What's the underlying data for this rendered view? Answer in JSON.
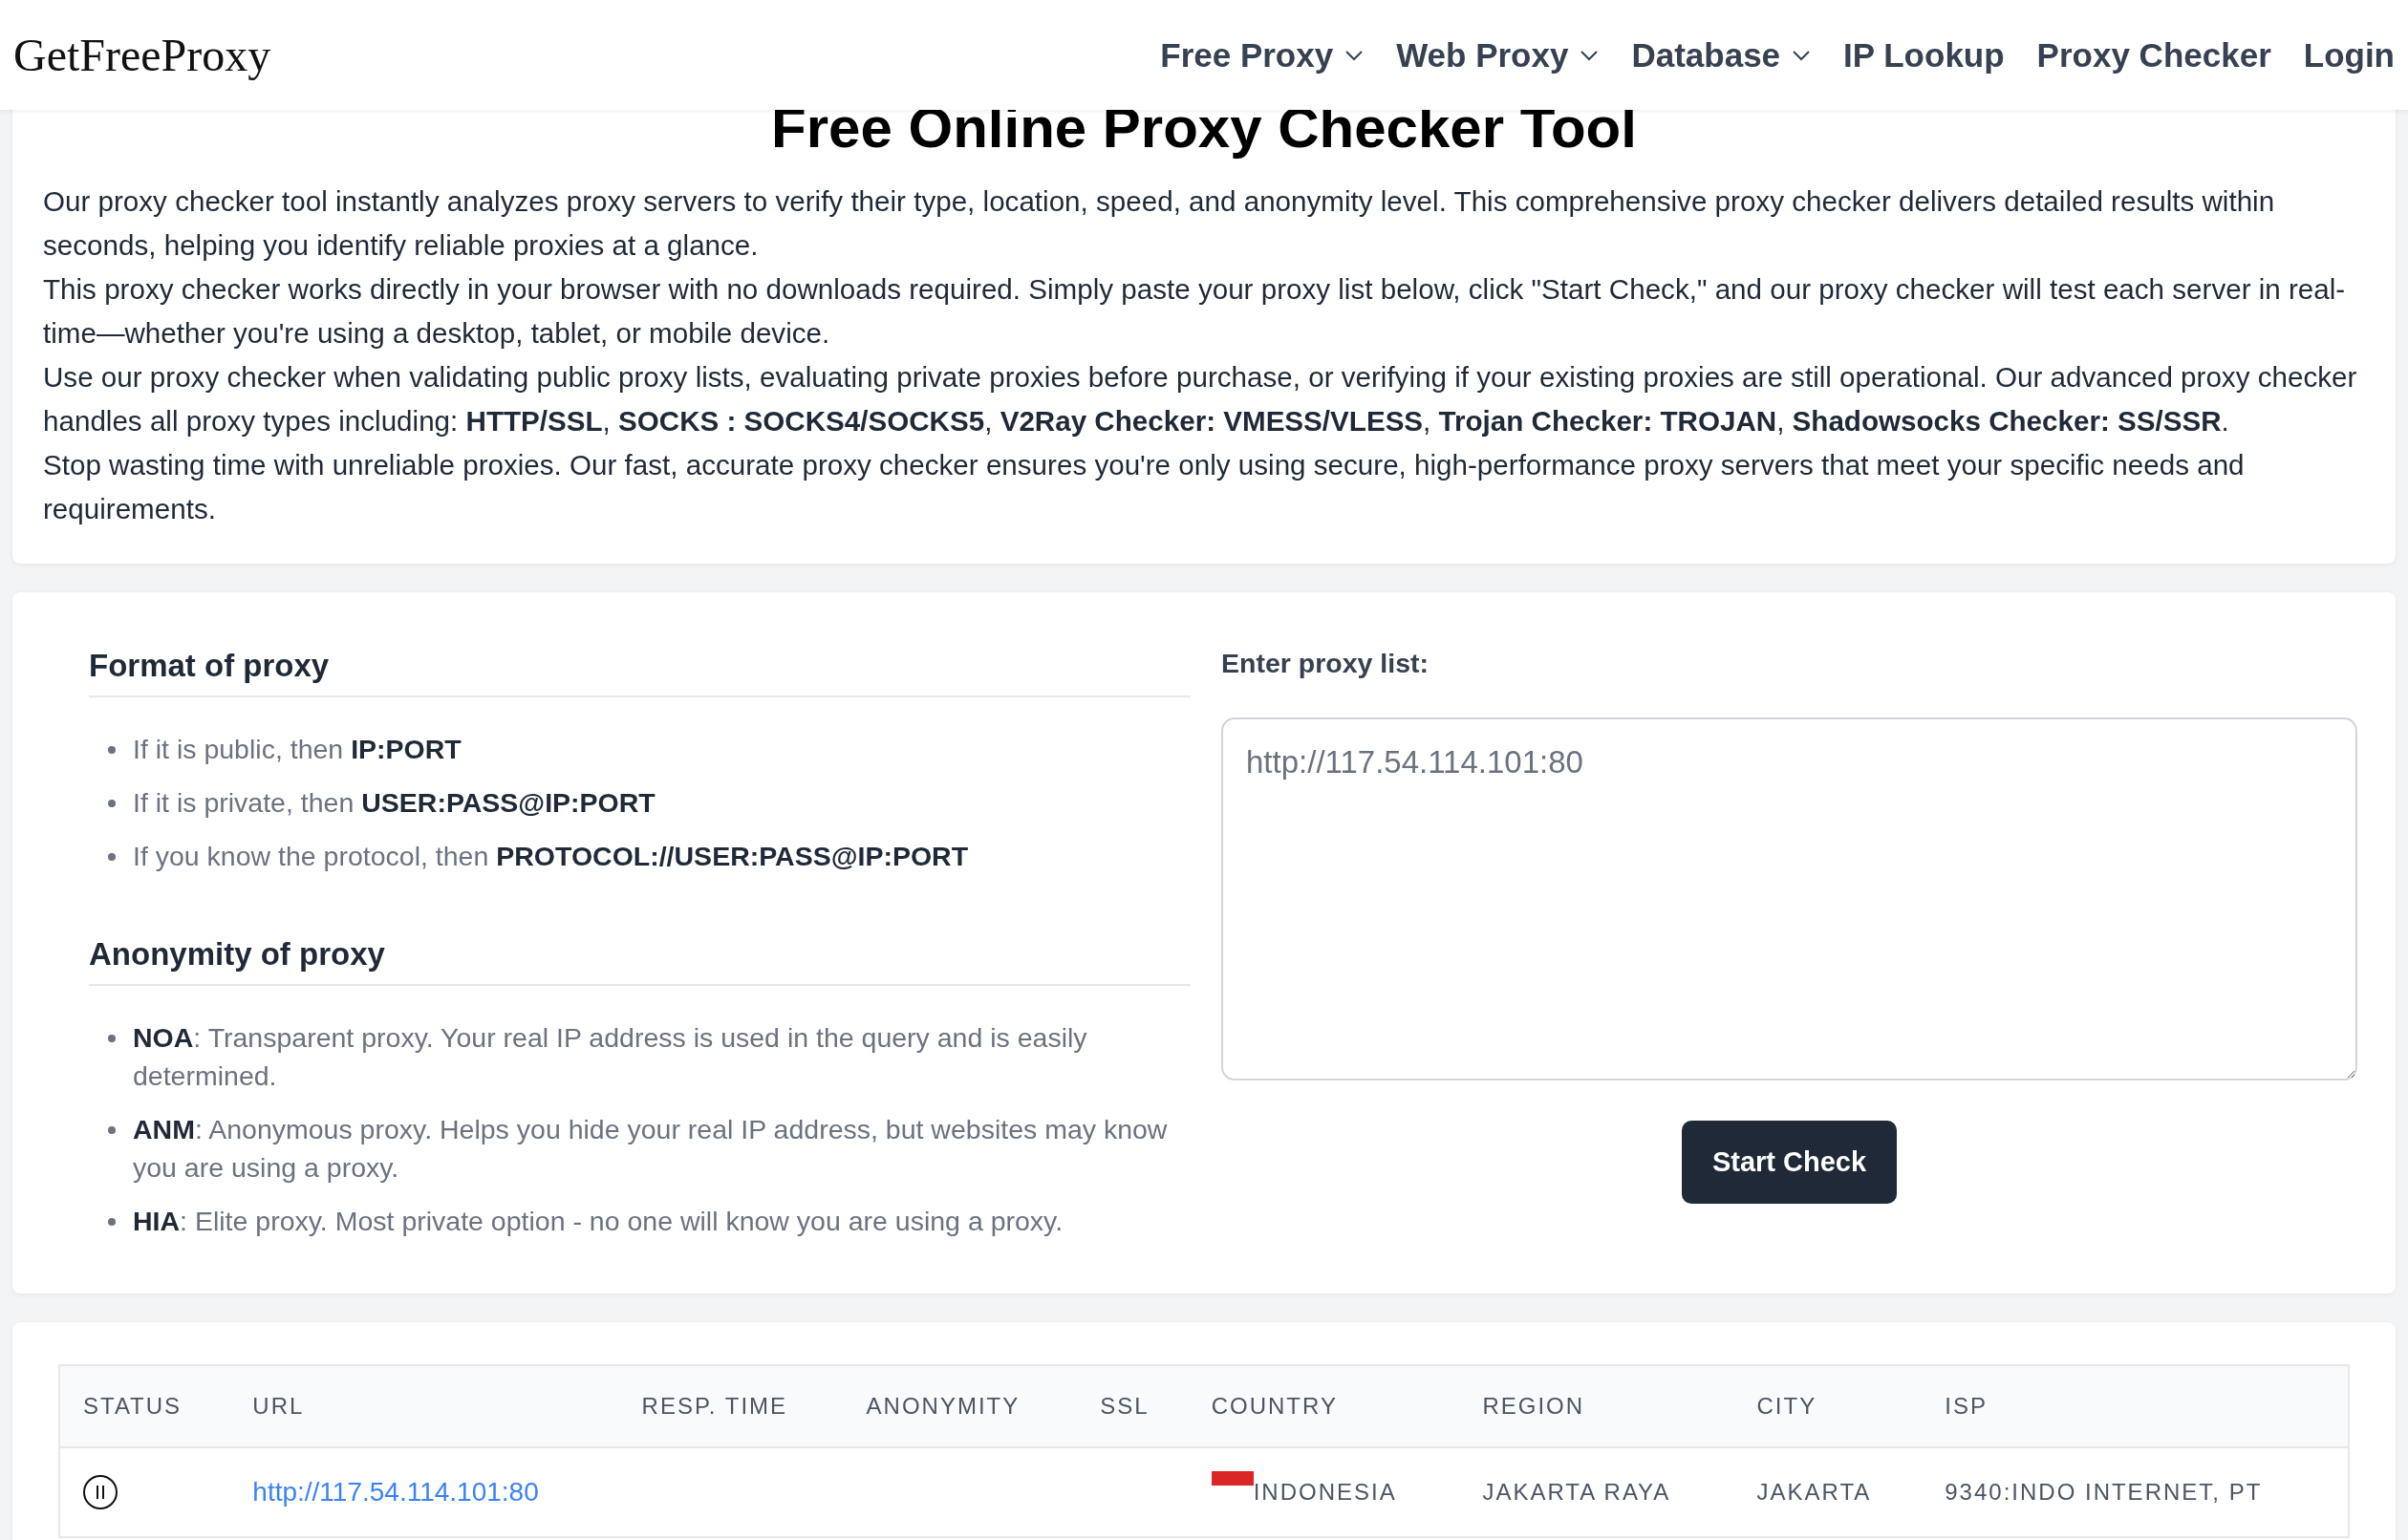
{
  "header": {
    "logo": "GetFreeProxy",
    "nav": [
      {
        "label": "Free Proxy",
        "dropdown": true
      },
      {
        "label": "Web Proxy",
        "dropdown": true
      },
      {
        "label": "Database",
        "dropdown": true
      },
      {
        "label": "IP Lookup",
        "dropdown": false
      },
      {
        "label": "Proxy Checker",
        "dropdown": false
      },
      {
        "label": "Login",
        "dropdown": false
      }
    ]
  },
  "intro": {
    "title": "Free Online Proxy Checker Tool",
    "paragraphs": [
      "Our proxy checker tool instantly analyzes proxy servers to verify their type, location, speed, and anonymity level. This comprehensive proxy checker delivers detailed results within seconds, helping you identify reliable proxies at a glance.",
      "This proxy checker works directly in your browser with no downloads required. Simply paste your proxy list below, click \"Start Check,\" and our proxy checker will test each server in real-time—whether you're using a desktop, tablet, or mobile device.",
      "Use our proxy checker when validating public proxy lists, evaluating private proxies before purchase, or verifying if your existing proxies are still operational. Our advanced proxy checker handles all proxy types including: **HTTP/SSL**, **SOCKS : SOCKS4/SOCKS5**, **V2Ray Checker: VMESS/VLESS**, **Trojan Checker: TROJAN**, **Shadowsocks Checker: SS/SSR**.",
      "Stop wasting time with unreliable proxies. Our fast, accurate proxy checker ensures you're only using secure, high-performance proxy servers that meet your specific needs and requirements."
    ]
  },
  "checker": {
    "sections": [
      {
        "heading": "Format of proxy",
        "items": [
          "If it is public, then **IP:PORT**",
          "If it is private, then **USER:PASS@IP:PORT**",
          "If you know the protocol, then **PROTOCOL://USER:PASS@IP:PORT**"
        ]
      },
      {
        "heading": "Anonymity of proxy",
        "items": [
          "**NOA**: Transparent proxy. Your real IP address is used in the query and is easily determined.",
          "**ANM**: Anonymous proxy. Helps you hide your real IP address, but websites may know you are using a proxy.",
          "**HIA**: Elite proxy. Most private option - no one will know you are using a proxy."
        ]
      }
    ],
    "input_label": "Enter proxy list:",
    "input_value": "http://117.54.114.101:80",
    "button": "Start Check"
  },
  "results": {
    "columns": [
      "STATUS",
      "URL",
      "RESP. TIME",
      "ANONYMITY",
      "SSL",
      "COUNTRY",
      "REGION",
      "CITY",
      "ISP"
    ],
    "rows": [
      {
        "kind": "paused",
        "url": "http://117.54.114.101:80",
        "country": "INDONESIA",
        "region": "JAKARTA RAYA",
        "city": "JAKARTA",
        "isp": "9340:INDO INTERNET, PT"
      }
    ]
  }
}
